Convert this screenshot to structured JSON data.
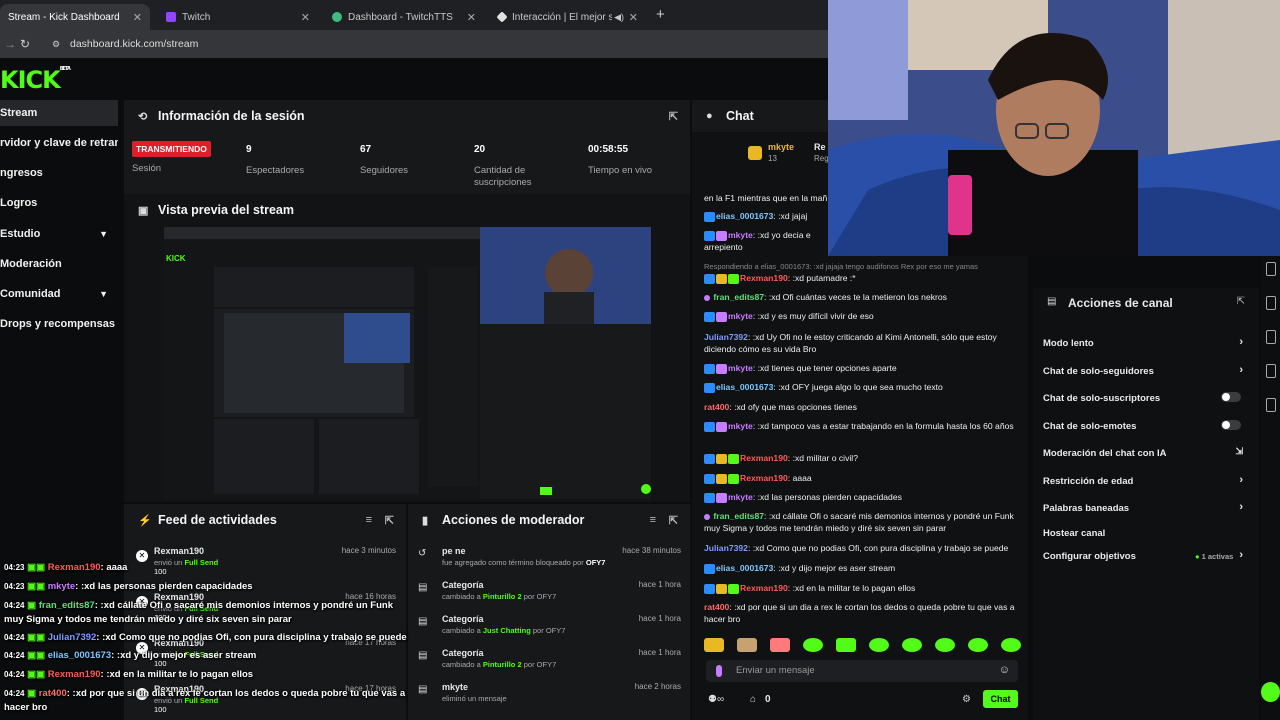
{
  "browser": {
    "tabs": [
      {
        "title": "Stream - Kick Dashboard",
        "color": "#53fc18"
      },
      {
        "title": "Twitch",
        "color": "#9146ff"
      },
      {
        "title": "Dashboard - TwitchTTS",
        "color": "#3dbd7d"
      },
      {
        "title": "Interacción | El mejor softw",
        "color": "#e0e0e0"
      }
    ],
    "new_tab": "+",
    "url": "dashboard.kick.com/stream"
  },
  "logo": "KICK",
  "logo_sup": "BETA",
  "sidebar": [
    {
      "label": "Stream",
      "active": true
    },
    {
      "label": "rvidor y clave de retransn"
    },
    {
      "label": "ngresos"
    },
    {
      "label": "Logros"
    },
    {
      "label": "Estudio",
      "chevron": true
    },
    {
      "label": "Moderación"
    },
    {
      "label": "Comunidad",
      "chevron": true
    },
    {
      "label": "Drops y recompensas"
    }
  ],
  "session": {
    "title": "Información de la sesión",
    "badge": "TRANSMITIENDO",
    "badge_label": "Sesión",
    "stats": [
      {
        "value": "9",
        "label": "Espectadores"
      },
      {
        "value": "67",
        "label": "Seguidores"
      },
      {
        "value": "20",
        "label": "Cantidad de suscripciones"
      },
      {
        "value": "00:58:55",
        "label": "Tiempo en vivo"
      }
    ]
  },
  "preview": {
    "title": "Vista previa del stream"
  },
  "feed": {
    "title": "Feed de actividades",
    "items": [
      {
        "name": "Rexman190",
        "sub": "envió un",
        "gift": "Full Send",
        "amount": "100",
        "time": "hace 3 minutos"
      },
      {
        "name": "Rexman190",
        "sub": "envió un",
        "gift": "Full Send",
        "amount": "100",
        "time": "hace 16 horas"
      },
      {
        "name": "Rexman190",
        "sub": "envió un",
        "gift": "Full Send",
        "amount": "100",
        "time": "hace 17 horas"
      },
      {
        "name": "Rexman190",
        "sub": "envió un",
        "gift": "Full Send",
        "amount": "100",
        "time": "hace 17 horas"
      }
    ]
  },
  "mod": {
    "title": "Acciones de moderador",
    "items": [
      {
        "name": "pe ne",
        "sub": "fue agregado como término bloqueado por",
        "by": "OFY7",
        "extra": "",
        "time": "hace 38 minutos"
      },
      {
        "name": "Categoría",
        "sub": "cambiado a",
        "by": "Pinturillo 2",
        "extra": "por OFY7",
        "time": "hace 1 hora"
      },
      {
        "name": "Categoría",
        "sub": "cambiado a",
        "by": "Just Chatting",
        "extra": "por OFY7",
        "time": "hace 1 hora"
      },
      {
        "name": "Categoría",
        "sub": "cambiado a",
        "by": "Pinturillo 2",
        "extra": "por OFY7",
        "time": "hace 1 hora"
      },
      {
        "name": "mkyte",
        "sub": "eliminó un mensaje",
        "by": "",
        "extra": "",
        "time": "hace 2 horas"
      }
    ]
  },
  "chat": {
    "title": "Chat",
    "pinned_user": "mkyte",
    "pinned_count": "13",
    "pinned_text_a": "Re",
    "pinned_text_b": "Reg",
    "top_fragment": "en la F1 mientras que en la mañ",
    "reply_hint": "Respondiendo a elias_0001673: :xd jajaja tengo audifonos Rex por eso me yamas",
    "messages": [
      {
        "user": "elias_0001673",
        "color": "#7ec8ff",
        "text": ":xd jajaj"
      },
      {
        "user": "mkyte",
        "color": "#c77dff",
        "text": ":xd yo decia e arrepiento"
      },
      {
        "user": "Rexman190",
        "color": "#ff5a5a",
        "text": ":xd putamadre :*"
      },
      {
        "user": "fran_edits87",
        "color": "#5fe07a",
        "text": ":xd Ofi cuántas veces te la metieron los nekros"
      },
      {
        "user": "mkyte",
        "color": "#c77dff",
        "text": ":xd y es muy difícil vivir de eso"
      },
      {
        "user": "Julian7392",
        "color": "#7e9cff",
        "text": ":xd Uy Ofi no le estoy criticando al Kimi Antonelli, sólo que estoy diciendo cómo es su vida Bro"
      },
      {
        "user": "mkyte",
        "color": "#c77dff",
        "text": ":xd tienes que tener opciones aparte"
      },
      {
        "user": "elias_0001673",
        "color": "#7ec8ff",
        "text": ":xd OFY juega algo lo que sea mucho texto"
      },
      {
        "user": "rat400",
        "color": "#ff6b6b",
        "text": ":xd ofy que mas opciones tienes"
      },
      {
        "user": "mkyte",
        "color": "#c77dff",
        "text": ":xd tampoco vas a estar trabajando en la formula hasta los 60 años"
      },
      {
        "user": "Rexman190",
        "color": "#ff5a5a",
        "text": ":xd militar o civil?"
      },
      {
        "user": "Rexman190",
        "color": "#ff5a5a",
        "text": "aaaa"
      },
      {
        "user": "mkyte",
        "color": "#c77dff",
        "text": ":xd las personas pierden capacidades"
      },
      {
        "user": "fran_edits87",
        "color": "#5fe07a",
        "text": ":xd cállate Ofi o sacaré mis demonios internos y pondré un Funk muy Sigma y todos me tendrán miedo y diré six seven sin parar"
      },
      {
        "user": "Julian7392",
        "color": "#7e9cff",
        "text": ":xd Como que no podias Ofi, con pura disciplina y trabajo se puede"
      },
      {
        "user": "elias_0001673",
        "color": "#7ec8ff",
        "text": ":xd y dijo mejor es aser stream"
      },
      {
        "user": "Rexman190",
        "color": "#ff5a5a",
        "text": ":xd en la militar te lo pagan ellos"
      },
      {
        "user": "rat400",
        "color": "#ff6b6b",
        "text": ":xd por que si un dia a rex le cortan los dedos o queda pobre tu que vas a hacer bro"
      }
    ],
    "input_placeholder": "Enviar un mensaje",
    "viewer_count": "0",
    "send_label": "Chat"
  },
  "overlay": [
    {
      "time": "04:23",
      "user": "Rexman190",
      "color": "#ff5a5a",
      "text": "aaaa"
    },
    {
      "time": "04:23",
      "user": "mkyte",
      "color": "#c77dff",
      "text": ":xd las personas pierden capacidades"
    },
    {
      "time": "04:24",
      "user": "fran_edits87",
      "color": "#5fe07a",
      "text": ":xd cállate Ofi o sacaré mis demonios internos y pondré un Funk"
    },
    {
      "time": "",
      "user": "",
      "color": "#fff",
      "text": "muy Sigma y todos me tendrán miedo y diré six seven sin parar"
    },
    {
      "time": "04:24",
      "user": "Julian7392",
      "color": "#7e9cff",
      "text": ":xd Como que no podias Ofi, con pura disciplina y trabajo se puede"
    },
    {
      "time": "04:24",
      "user": "elias_0001673",
      "color": "#7ec8ff",
      "text": ":xd y dijo mejor es aser stream"
    },
    {
      "time": "04:24",
      "user": "Rexman190",
      "color": "#ff5a5a",
      "text": ":xd en la militar te lo pagan ellos"
    },
    {
      "time": "04:24",
      "user": "rat400",
      "color": "#ff6b6b",
      "text": ":xd por que si un dia a rex le cortan los dedos o queda pobre tu que vas a"
    },
    {
      "time": "",
      "user": "",
      "color": "#fff",
      "text": "hacer bro"
    }
  ],
  "channel_actions": {
    "title": "Acciones de canal",
    "items": [
      {
        "label": "Modo lento",
        "control": "chevron"
      },
      {
        "label": "Chat de solo-seguidores",
        "control": "chevron"
      },
      {
        "label": "Chat de solo-suscriptores",
        "control": "toggle"
      },
      {
        "label": "Chat de solo-emotes",
        "control": "toggle"
      },
      {
        "label": "Moderación del chat con IA",
        "control": "link"
      },
      {
        "label": "Restricción de edad",
        "control": "chevron"
      },
      {
        "label": "Palabras baneadas",
        "control": "chevron"
      },
      {
        "label": "Hostear canal",
        "control": "none"
      },
      {
        "label": "Configurar objetivos",
        "control": "chevron",
        "status": "1 activas"
      }
    ]
  },
  "colors": {
    "kick_green": "#53fc18",
    "live_red": "#e11d2b"
  }
}
